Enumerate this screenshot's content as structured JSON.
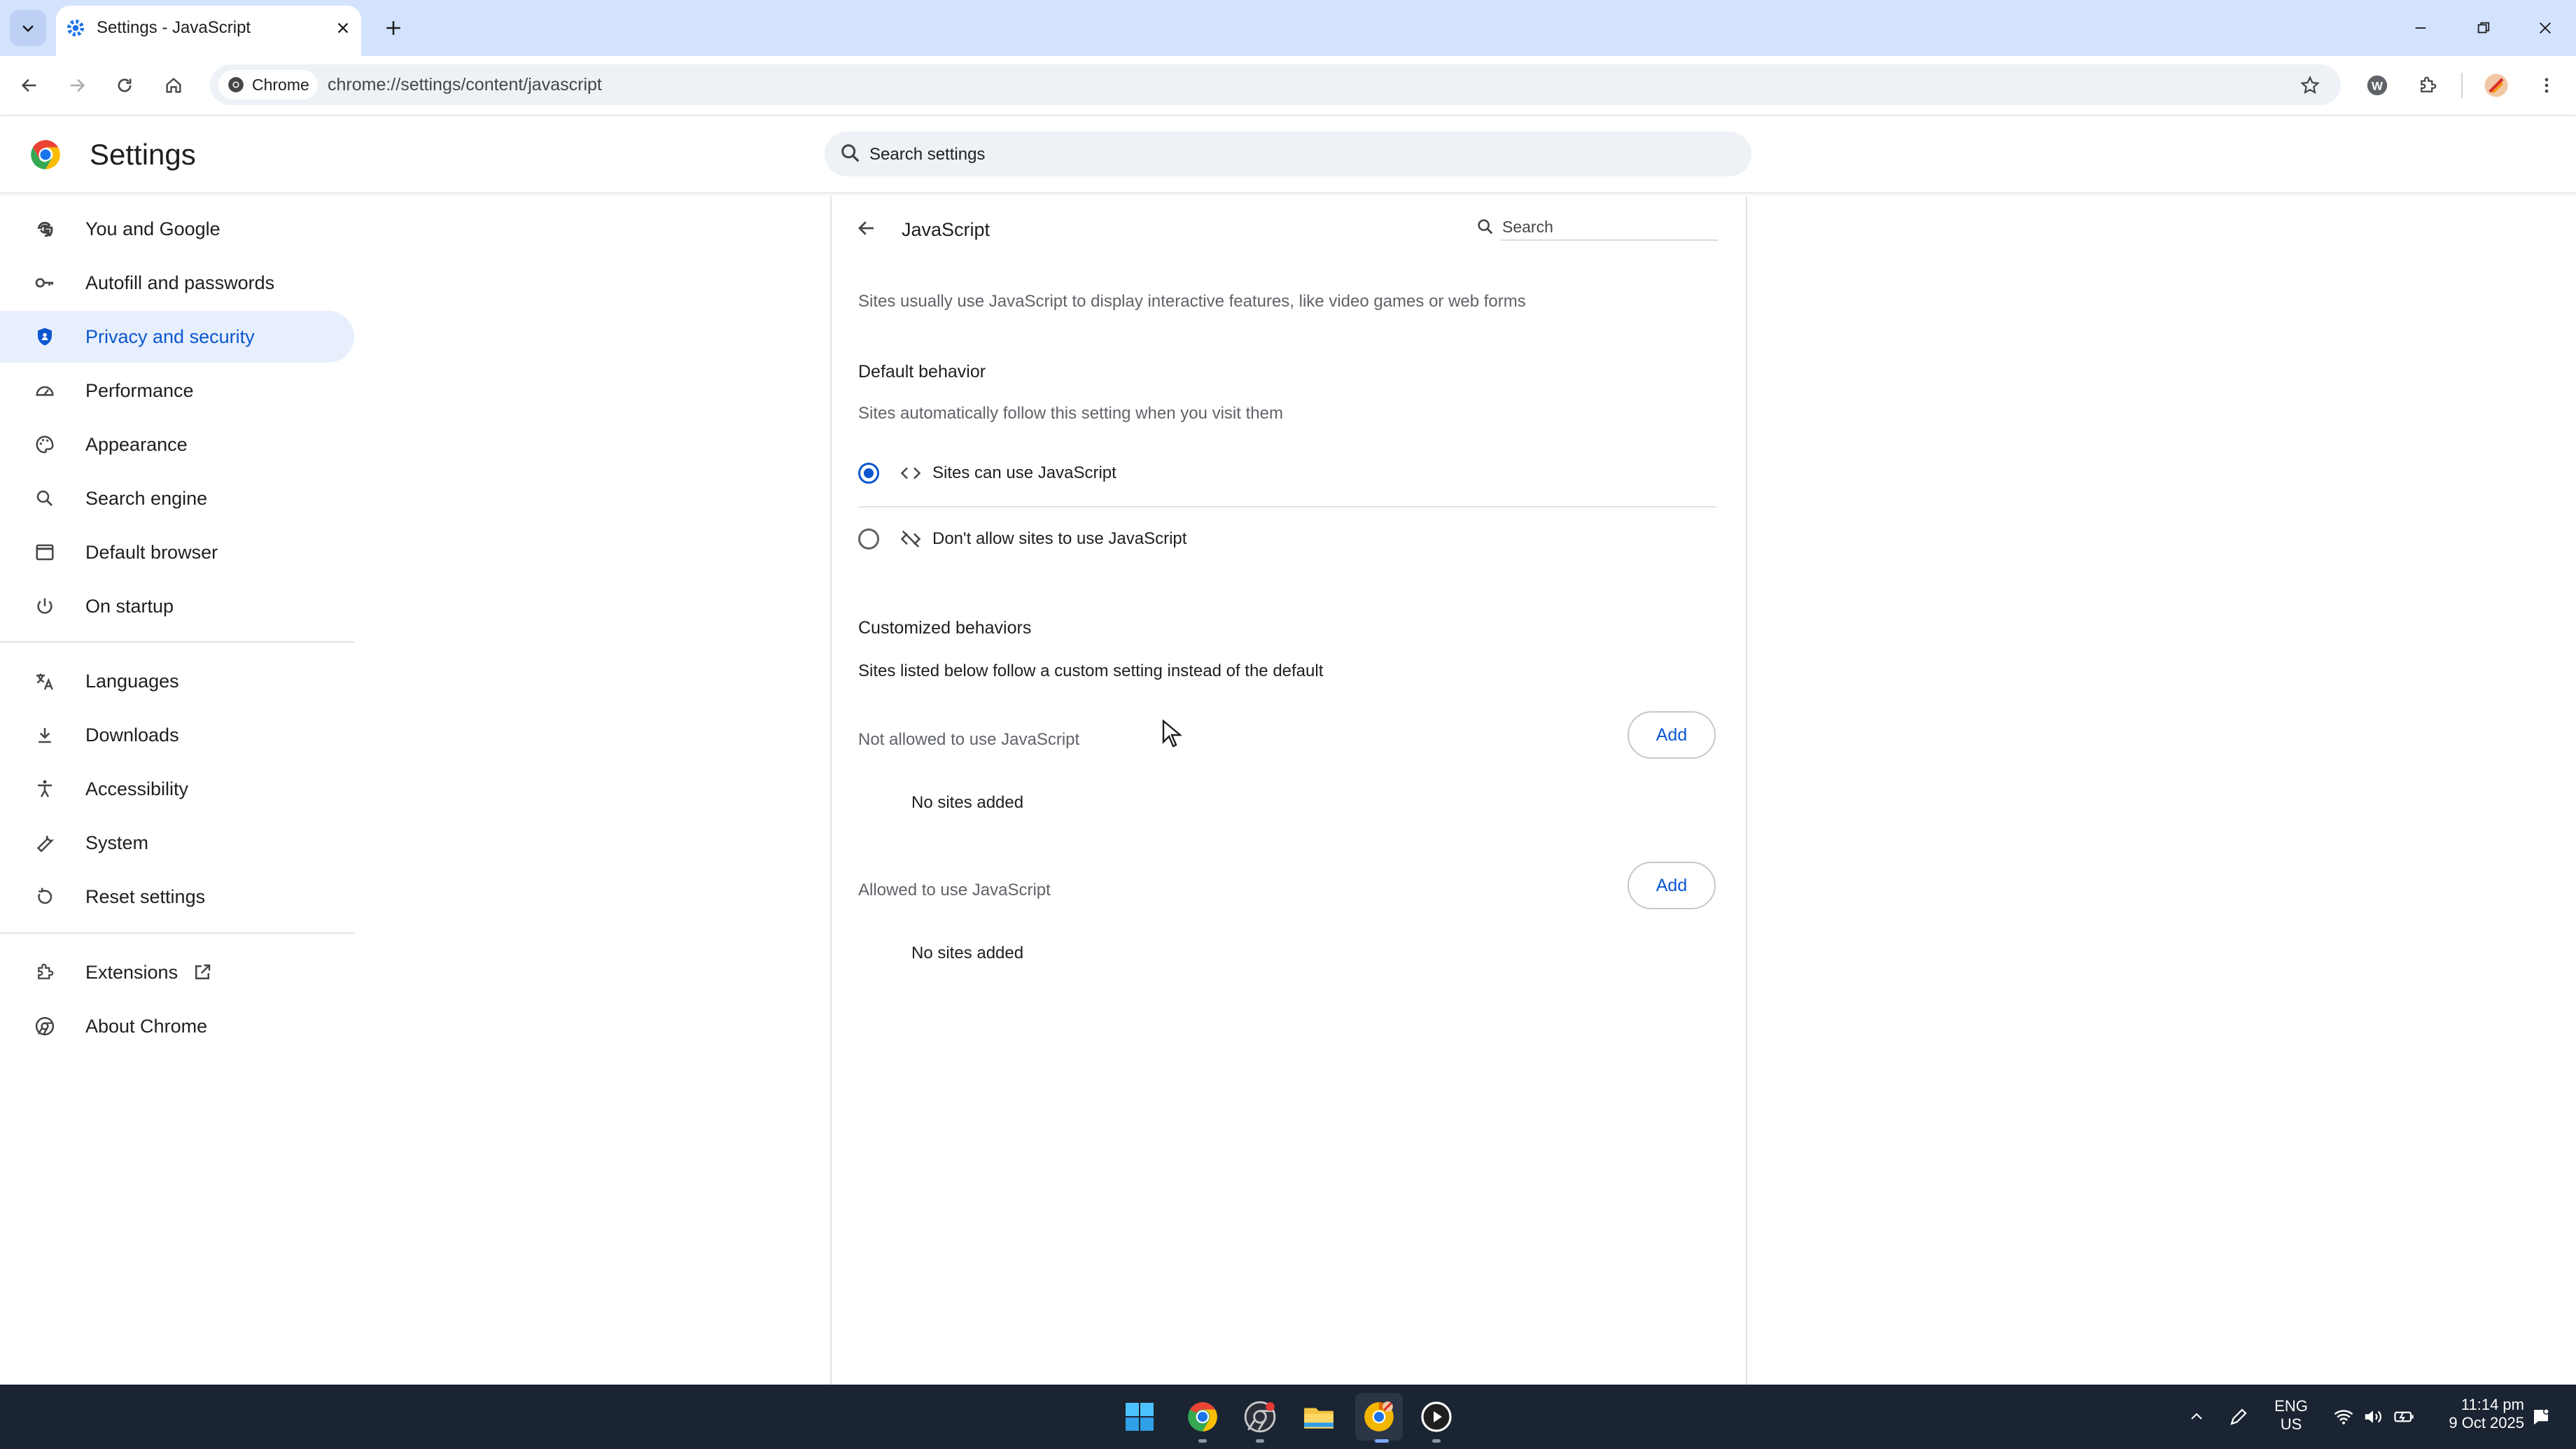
{
  "browser": {
    "tab_title": "Settings - JavaScript",
    "chip_label": "Chrome",
    "url": "chrome://settings/content/javascript"
  },
  "header": {
    "title": "Settings",
    "search_placeholder": "Search settings"
  },
  "sidebar": {
    "items": [
      {
        "label": "You and Google",
        "icon": "google-g-icon"
      },
      {
        "label": "Autofill and passwords",
        "icon": "key-icon"
      },
      {
        "label": "Privacy and security",
        "icon": "shield-icon",
        "active": true
      },
      {
        "label": "Performance",
        "icon": "speedometer-icon"
      },
      {
        "label": "Appearance",
        "icon": "palette-icon"
      },
      {
        "label": "Search engine",
        "icon": "search-icon"
      },
      {
        "label": "Default browser",
        "icon": "browser-window-icon"
      },
      {
        "label": "On startup",
        "icon": "power-icon"
      },
      {
        "label": "Languages",
        "icon": "translate-icon"
      },
      {
        "label": "Downloads",
        "icon": "download-icon"
      },
      {
        "label": "Accessibility",
        "icon": "accessibility-icon"
      },
      {
        "label": "System",
        "icon": "wrench-icon"
      },
      {
        "label": "Reset settings",
        "icon": "reset-icon"
      },
      {
        "label": "Extensions",
        "icon": "puzzle-icon"
      },
      {
        "label": "About Chrome",
        "icon": "chrome-icon"
      }
    ]
  },
  "page": {
    "title": "JavaScript",
    "search_placeholder": "Search",
    "description": "Sites usually use JavaScript to display interactive features, like video games or web forms",
    "default_behavior": {
      "heading": "Default behavior",
      "subtext": "Sites automatically follow this setting when you visit them",
      "options": [
        {
          "label": "Sites can use JavaScript",
          "icon": "code-icon",
          "selected": true
        },
        {
          "label": "Don't allow sites to use JavaScript",
          "icon": "code-off-icon",
          "selected": false
        }
      ]
    },
    "customized": {
      "heading": "Customized behaviors",
      "subtext": "Sites listed below follow a custom setting instead of the default",
      "lists": [
        {
          "label": "Not allowed to use JavaScript",
          "button": "Add",
          "empty": "No sites added"
        },
        {
          "label": "Allowed to use JavaScript",
          "button": "Add",
          "empty": "No sites added"
        }
      ]
    }
  },
  "taskbar": {
    "lang_top": "ENG",
    "lang_bottom": "US",
    "time": "11:14 pm",
    "date": "9 Oct 2025"
  },
  "colors": {
    "accent": "#0b57d0",
    "tabstrip": "#d3e3fd",
    "active_nav_bg": "#e8effc",
    "taskbar": "#1b2432"
  }
}
